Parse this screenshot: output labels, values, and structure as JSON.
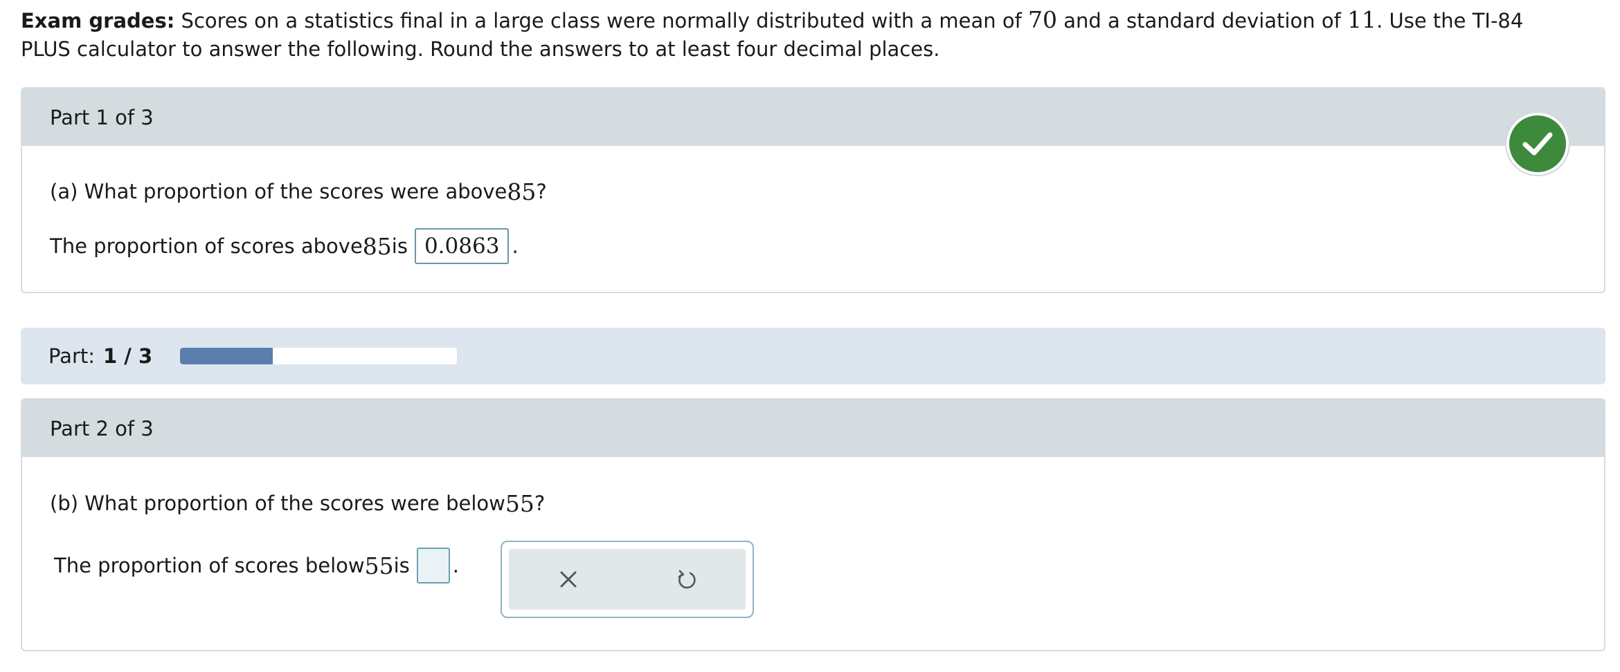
{
  "intro": {
    "bold_label": "Exam grades:",
    "text_1": " Scores on a statistics final in a large class were normally distributed with a mean of ",
    "mean": "70",
    "text_2": " and a standard deviation of ",
    "sd": "11",
    "text_3": ". Use the TI-84 PLUS calculator to answer the following. Round the answers to at least four decimal places."
  },
  "part1": {
    "header": "Part 1 of 3",
    "question_prefix": "(a) What proportion of the scores were above ",
    "question_value": "85",
    "question_suffix": "?",
    "answer_prefix": "The proportion of scores above ",
    "answer_value_num": "85",
    "answer_mid": " is",
    "answer": "0.0863",
    "answer_suffix": ".",
    "status": "correct",
    "status_icon": "checkmark-icon"
  },
  "progress": {
    "label": "Part:",
    "value_text": "1 / 3",
    "current": 1,
    "total": 3,
    "bar_color": "#5a7fad"
  },
  "part2": {
    "header": "Part 2 of 3",
    "question_prefix": "(b) What proportion of the scores were below ",
    "question_value": "55",
    "question_suffix": "?",
    "answer_prefix": "The proportion of scores below ",
    "answer_value_num": "55",
    "answer_mid": " is",
    "answer": "",
    "answer_suffix": "."
  },
  "toolbar": {
    "clear_icon": "close-icon",
    "undo_icon": "undo-icon"
  },
  "colors": {
    "header_bg": "#d4dcdf",
    "progress_bg": "#dde6ee",
    "check_green": "#3d8a3d"
  }
}
